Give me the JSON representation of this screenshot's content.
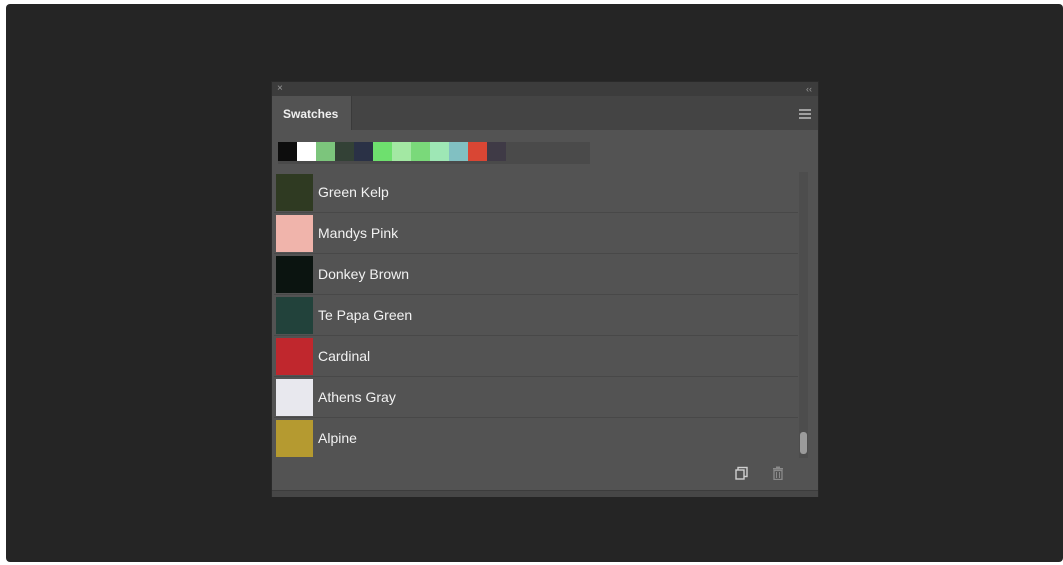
{
  "panel": {
    "tab_label": "Swatches",
    "close_glyph": "×",
    "collapse_glyph": "‹‹"
  },
  "recent_swatches": [
    {
      "color": "#0d0d0d"
    },
    {
      "color": "#ffffff"
    },
    {
      "color": "#7cc57c"
    },
    {
      "color": "#334136"
    },
    {
      "color": "#2a3146"
    },
    {
      "color": "#6ee06e"
    },
    {
      "color": "#a3e8a3"
    },
    {
      "color": "#7ad97a"
    },
    {
      "color": "#9ee7b5"
    },
    {
      "color": "#81c0c2"
    },
    {
      "color": "#d94634"
    },
    {
      "color": "#3f3a46"
    }
  ],
  "swatches": [
    {
      "label": "Green Kelp",
      "color": "#2f3a22"
    },
    {
      "label": "Mandys Pink",
      "color": "#f0b4ab"
    },
    {
      "label": "Donkey Brown",
      "color": "#0b1410"
    },
    {
      "label": "Te Papa Green",
      "color": "#22423b"
    },
    {
      "label": "Cardinal",
      "color": "#c0272d"
    },
    {
      "label": "Athens Gray",
      "color": "#e8e8ee"
    },
    {
      "label": "Alpine",
      "color": "#b59a30"
    }
  ],
  "icons": {
    "menu": "hamburger-menu-icon",
    "new_swatch": "new-swatch-icon",
    "delete": "trash-icon"
  }
}
